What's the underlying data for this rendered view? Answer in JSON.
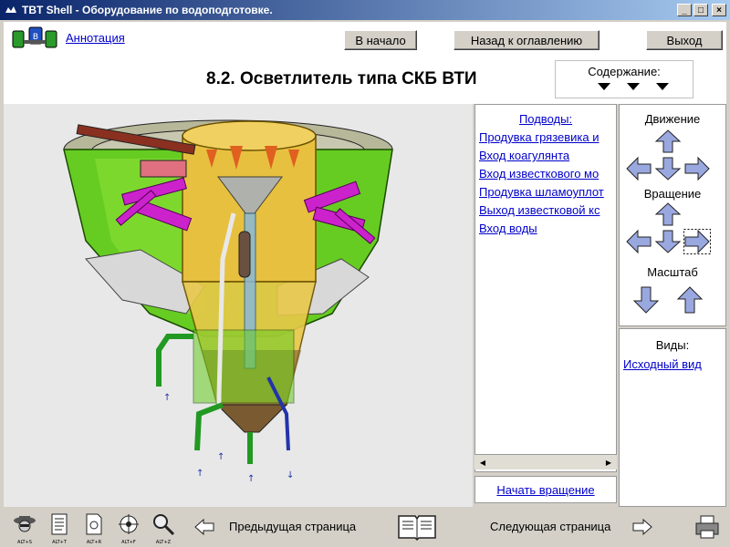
{
  "window": {
    "title": "TBT Shell - Оборудование по водоподготовке."
  },
  "header": {
    "annotation_link": "Аннотация",
    "home_button": "В начало",
    "back_button": "Назад к оглавлению",
    "exit_button": "Выход",
    "page_title": "8.2. Осветлитель типа СКБ ВТИ",
    "contents_label": "Содержание:"
  },
  "links_panel": {
    "heading": "Подводы:",
    "items": [
      "Продувка грязевика и",
      "Вход коагулянта",
      "Вход известкового мо",
      "Продувка шламоуплот",
      "Выход известковой кс",
      "Вход воды"
    ],
    "start_rotation": "Начать вращение"
  },
  "nav_panel": {
    "movement_label": "Движение",
    "rotation_label": "Вращение",
    "scale_label": "Масштаб"
  },
  "views_panel": {
    "label": "Виды:",
    "default_view": "Исходный вид"
  },
  "footer": {
    "icon_captions": [
      "ALT+S",
      "ALT+T",
      "ALT+R",
      "ALT+F",
      "ALT+Z"
    ],
    "prev_page": "Предыдущая страница",
    "next_page": "Следующая страница"
  },
  "colors": {
    "titlebar_start": "#0a246a",
    "titlebar_end": "#a6caf0",
    "link": "#0000cc",
    "arrow_fill": "#9aa8e0",
    "tank_green": "#66cc22",
    "tank_yellow": "#e8c040",
    "pipe_magenta": "#cc22cc"
  }
}
